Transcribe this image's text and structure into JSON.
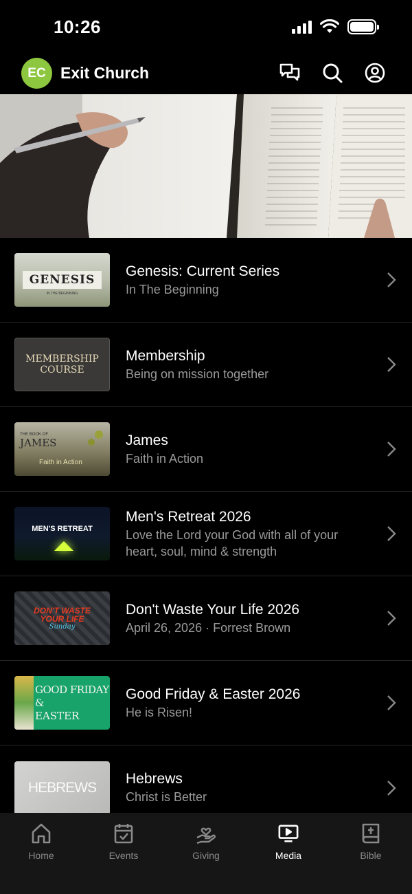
{
  "status": {
    "time": "10:26"
  },
  "header": {
    "logo_text": "EC",
    "title": "Exit Church"
  },
  "colors": {
    "brand": "#8dc63f",
    "background": "#000000",
    "tab_bar": "#161616",
    "subtitle": "#9a9a9a"
  },
  "series": [
    {
      "title": "Genesis: Current Series",
      "subtitle": "In The Beginning",
      "thumb_text": "GENESIS",
      "thumb_sub": "IN THE BEGINNING"
    },
    {
      "title": "Membership",
      "subtitle": "Being on mission together",
      "thumb_text": "MEMBERSHIP",
      "thumb_sub": "COURSE"
    },
    {
      "title": "James",
      "subtitle": "Faith in Action",
      "thumb_text": "JAMES",
      "thumb_pre": "THE BOOK OF",
      "thumb_sub": "Faith in Action"
    },
    {
      "title": "Men's Retreat 2026",
      "subtitle": "Love the Lord your God with all of your heart, soul, mind & strength",
      "thumb_text": "MEN'S RETREAT"
    },
    {
      "title": "Don't Waste Your Life 2026",
      "subtitle": "April 26, 2026 · Forrest Brown",
      "thumb_text": "DON'T WASTE",
      "thumb_text2": "YOUR LIFE",
      "thumb_sub": "Sunday"
    },
    {
      "title": "Good Friday & Easter 2026",
      "subtitle": "He is Risen!",
      "thumb_text": "GOOD FRIDAY",
      "thumb_text2": "&",
      "thumb_sub": "EASTER"
    },
    {
      "title": "Hebrews",
      "subtitle": "Christ is Better",
      "thumb_text": "HEBREWS"
    }
  ],
  "tabs": [
    {
      "label": "Home",
      "icon": "home-icon",
      "active": false
    },
    {
      "label": "Events",
      "icon": "calendar-check-icon",
      "active": false
    },
    {
      "label": "Giving",
      "icon": "hand-heart-icon",
      "active": false
    },
    {
      "label": "Media",
      "icon": "tv-play-icon",
      "active": true
    },
    {
      "label": "Bible",
      "icon": "bible-icon",
      "active": false
    }
  ]
}
